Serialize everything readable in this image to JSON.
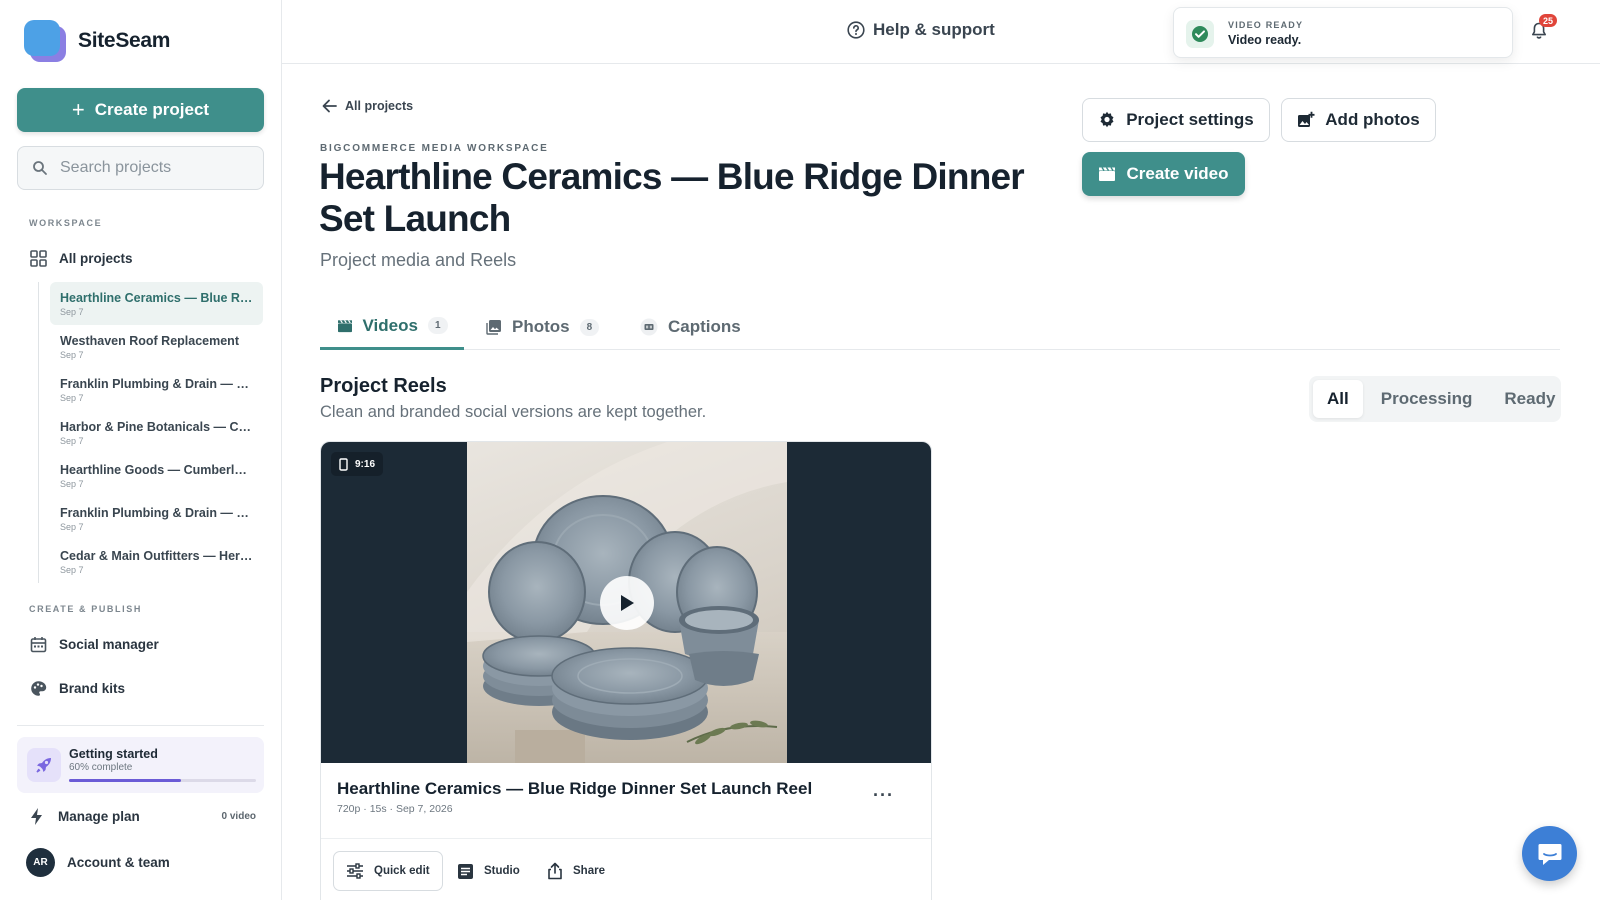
{
  "app": {
    "name": "SiteSeam"
  },
  "sidebar": {
    "create_label": "Create project",
    "search_placeholder": "Search projects",
    "workspace_label": "WORKSPACE",
    "all_projects_label": "All projects",
    "projects": [
      {
        "title": "Hearthline Ceramics — Blue Rid…",
        "date": "Sep 7",
        "active": true
      },
      {
        "title": "Westhaven Roof Replacement",
        "date": "Sep 7"
      },
      {
        "title": "Franklin Plumbing & Drain — Jo…",
        "date": "Sep 7"
      },
      {
        "title": "Harbor & Pine Botanicals — Coa…",
        "date": "Sep 7"
      },
      {
        "title": "Hearthline Goods — Cumberlan…",
        "date": "Sep 7"
      },
      {
        "title": "Franklin Plumbing & Drain — W…",
        "date": "Sep 7"
      },
      {
        "title": "Cedar & Main Outfitters — Herit…",
        "date": "Sep 7"
      }
    ],
    "create_publish_label": "CREATE & PUBLISH",
    "social_manager_label": "Social manager",
    "brand_kits_label": "Brand kits",
    "getting_started": {
      "title": "Getting started",
      "subtitle": "60% complete",
      "progress": 0.6
    },
    "manage_plan": {
      "label": "Manage plan",
      "count": "0 video"
    },
    "account": {
      "initials": "AR",
      "label": "Account & team"
    }
  },
  "topbar": {
    "help_label": "Help & support",
    "toast": {
      "label": "VIDEO READY",
      "message": "Video ready."
    },
    "notification_count": "25"
  },
  "main": {
    "back_label": "All projects",
    "workspace_label": "BIGCOMMERCE MEDIA WORKSPACE",
    "title": "Hearthline Ceramics — Blue Ridge Dinner Set Launch",
    "subtitle": "Project media and Reels",
    "buttons": {
      "project_settings": "Project settings",
      "add_photos": "Add photos",
      "create_video": "Create video"
    },
    "tabs": [
      {
        "label": "Videos",
        "count": "1",
        "active": true
      },
      {
        "label": "Photos",
        "count": "8"
      },
      {
        "label": "Captions"
      }
    ],
    "section": {
      "title": "Project Reels",
      "subtitle": "Clean and branded social versions are kept together."
    },
    "filters": [
      "All",
      "Processing",
      "Ready"
    ],
    "video": {
      "ratio": "9:16",
      "title": "Hearthline Ceramics — Blue Ridge Dinner Set Launch Reel",
      "meta": "720p · 15s · Sep 7, 2026",
      "actions": {
        "quick_edit": "Quick edit",
        "studio": "Studio",
        "share": "Share"
      }
    }
  },
  "colors": {
    "accent": "#3f8f8b",
    "dark": "#16222e",
    "progress": "#6b5bd6",
    "badge": "#e0453a",
    "chat": "#3d7fd6"
  }
}
